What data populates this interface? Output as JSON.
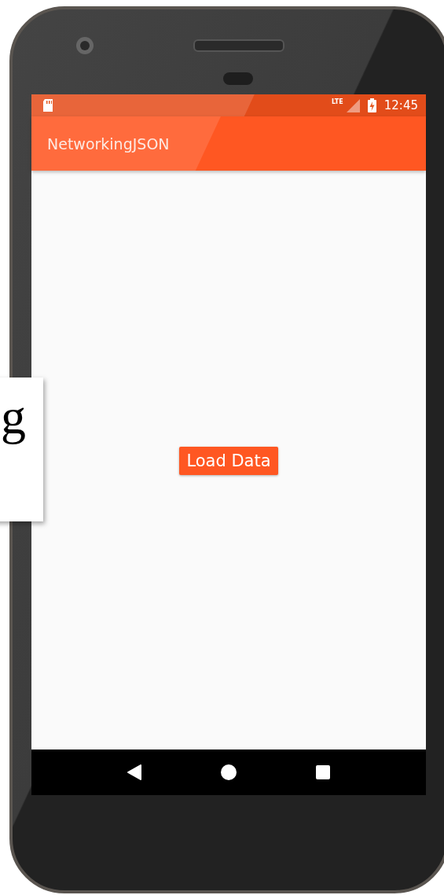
{
  "status_bar": {
    "network": "LTE",
    "time": "12:45"
  },
  "app_bar": {
    "title": "NetworkingJSON"
  },
  "load_button": {
    "label": "Load Data"
  },
  "side_card": {
    "text": "g"
  }
}
